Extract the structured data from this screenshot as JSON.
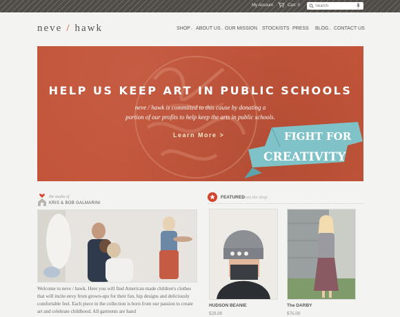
{
  "header": {
    "account": "My Account",
    "cart": "Cart: 0",
    "search_placeholder": "Search",
    "logo": {
      "left": "neve",
      "slash": "/",
      "right": "hawk"
    }
  },
  "nav": {
    "items": [
      {
        "label": "SHOP",
        "caret": true
      },
      {
        "label": "ABOUT US",
        "caret": true
      },
      {
        "label": "OUR MISSION",
        "caret": false
      },
      {
        "label": "STOCKISTS",
        "caret": false
      },
      {
        "label": "PRESS",
        "caret": false
      },
      {
        "label": "BLOG",
        "caret": true
      },
      {
        "label": "CONTACT US",
        "caret": false
      }
    ]
  },
  "banner": {
    "headline": "HELP US KEEP ART IN PUBLIC SCHOOLS",
    "sub_line1": "neve / hawk is committed to this cause by donating a",
    "sub_line2": "portion of our profits to help keep the arts in public schools.",
    "cta": "Learn More >",
    "ribbon_line1": "FIGHT FOR",
    "ribbon_line2": "CREATIVITY",
    "bg_color": "#c25439"
  },
  "studio": {
    "pre": "the studio of",
    "names": "KRIS & BOB GALMARINI",
    "text": "Welcome to neve / hawk. Here you will find American made children's clothes that will incite envy from grown-ups for their fun, hip designs and deliciously comfortable feel. Each piece in the collection is born from our passion to create art and celebrate childhood. All garments are hand"
  },
  "featured": {
    "label": "FEATURED",
    "sub": "from the shop",
    "products": [
      {
        "name": "HUDSON BEANIE",
        "price": "$28.00"
      },
      {
        "name": "The DARBY",
        "price": "$76.00"
      }
    ]
  },
  "colors": {
    "accent": "#d2452b",
    "ribbon": "#7fc3c9",
    "topbar": "#4f4b47"
  }
}
